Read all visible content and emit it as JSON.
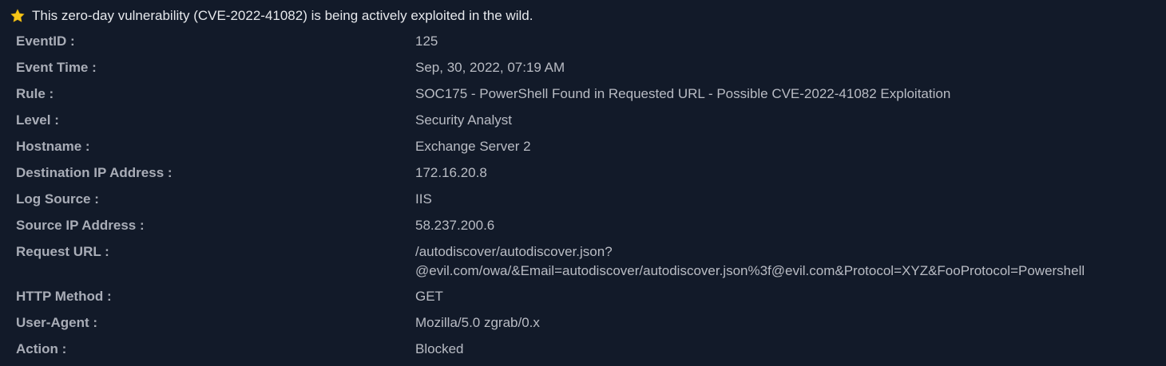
{
  "banner": {
    "icon": "star-icon",
    "icon_color": "#f5c518",
    "text": "This zero-day vulnerability (CVE-2022-41082) is being actively exploited in the wild."
  },
  "fields": [
    {
      "label": "EventID :",
      "value": "125"
    },
    {
      "label": "Event Time :",
      "value": "Sep, 30, 2022, 07:19 AM"
    },
    {
      "label": "Rule :",
      "value": "SOC175 - PowerShell Found in Requested URL - Possible CVE-2022-41082 Exploitation"
    },
    {
      "label": "Level :",
      "value": "Security Analyst"
    },
    {
      "label": "Hostname :",
      "value": "Exchange Server 2"
    },
    {
      "label": "Destination IP Address :",
      "value": "172.16.20.8"
    },
    {
      "label": "Log Source :",
      "value": "IIS"
    },
    {
      "label": "Source IP Address :",
      "value": "58.237.200.6"
    },
    {
      "label": "Request URL :",
      "value_line1": "/autodiscover/autodiscover.json?",
      "value_line2": "@evil.com/owa/&Email=autodiscover/autodiscover.json%3f@evil.com&Protocol=XYZ&FooProtocol=Powershell"
    },
    {
      "label": "HTTP Method :",
      "value": "GET"
    },
    {
      "label": "User-Agent :",
      "value": "Mozilla/5.0 zgrab/0.x"
    },
    {
      "label": "Action :",
      "value": "Blocked"
    }
  ]
}
